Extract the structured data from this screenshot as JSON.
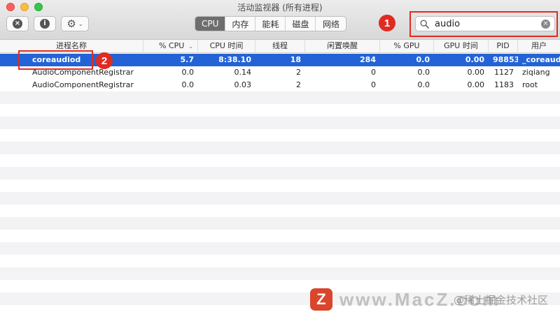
{
  "window": {
    "title": "活动监视器 (所有进程)"
  },
  "toolbar": {
    "stop_icon": "×",
    "info_icon": "i",
    "gear_icon": "⚙",
    "gear_chevron": "⌄",
    "tabs": [
      {
        "label": "CPU",
        "active": true
      },
      {
        "label": "内存",
        "active": false
      },
      {
        "label": "能耗",
        "active": false
      },
      {
        "label": "磁盘",
        "active": false
      },
      {
        "label": "网络",
        "active": false
      }
    ],
    "search": {
      "value": "audio",
      "search_icon": "magnifier-icon",
      "clear_icon": "×"
    }
  },
  "markers": {
    "one": "1",
    "two": "2",
    "color": "#e02b20"
  },
  "table": {
    "headers": [
      "进程名称",
      "% CPU",
      "CPU 时间",
      "线程",
      "闲置唤醒",
      "% GPU",
      "GPU 时间",
      "PID",
      "用户"
    ],
    "sort_indicator": "⌄",
    "rows": [
      {
        "name": "coreaudiod",
        "cpu": "5.7",
        "cpu_time": "8:38.10",
        "threads": "18",
        "idle_wakeups": "284",
        "gpu": "0.0",
        "gpu_time": "0.00",
        "pid": "98853",
        "user": "_coreaudiod"
      },
      {
        "name": "AudioComponentRegistrar",
        "cpu": "0.0",
        "cpu_time": "0.14",
        "threads": "2",
        "idle_wakeups": "0",
        "gpu": "0.0",
        "gpu_time": "0.00",
        "pid": "1127",
        "user": "ziqiang"
      },
      {
        "name": "AudioComponentRegistrar",
        "cpu": "0.0",
        "cpu_time": "0.03",
        "threads": "2",
        "idle_wakeups": "0",
        "gpu": "0.0",
        "gpu_time": "0.00",
        "pid": "1183",
        "user": "root"
      }
    ],
    "selected_row": 0,
    "selection_color": "#2463d5"
  },
  "watermark": {
    "logo": "Z",
    "text": "www.MacZ.com",
    "sub": "@稀土掘金技术社区"
  }
}
